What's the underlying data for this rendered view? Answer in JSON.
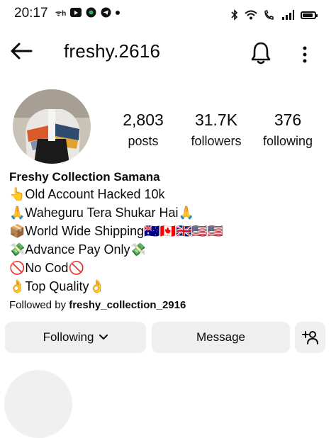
{
  "status_bar": {
    "time": "20:17",
    "left_icons": [
      "network-speed-icon",
      "youtube-icon",
      "app-icon",
      "telegram-icon",
      "notification-dot-icon"
    ],
    "right_icons": [
      "bluetooth-icon",
      "wifi-icon",
      "wifi-calling-icon",
      "signal-icon",
      "battery-icon"
    ],
    "battery_level": 0.85
  },
  "header": {
    "username": "freshy.2616",
    "back_icon": "arrow-left-icon",
    "bell_icon": "bell-icon",
    "more_icon": "more-vertical-icon"
  },
  "profile": {
    "stats": [
      {
        "value": "2,803",
        "label": "posts"
      },
      {
        "value": "31.7K",
        "label": "followers"
      },
      {
        "value": "376",
        "label": "following"
      }
    ],
    "bio": {
      "name": "Freshy Collection Samana",
      "lines": [
        "👆Old Account Hacked 10k",
        "🙏Waheguru Tera Shukar Hai🙏",
        "📦World Wide Shipping🇦🇺🇨🇦🇬🇧🇺🇸🇺🇸",
        "💸Advance Pay Only💸",
        "🚫No Cod🚫",
        "👌Top Quality👌"
      ],
      "followed_by_prefix": "Followed by",
      "followed_by_user": "freshy_collection_2916"
    }
  },
  "actions": {
    "following_label": "Following",
    "message_label": "Message",
    "add_user_icon": "add-person-icon"
  }
}
